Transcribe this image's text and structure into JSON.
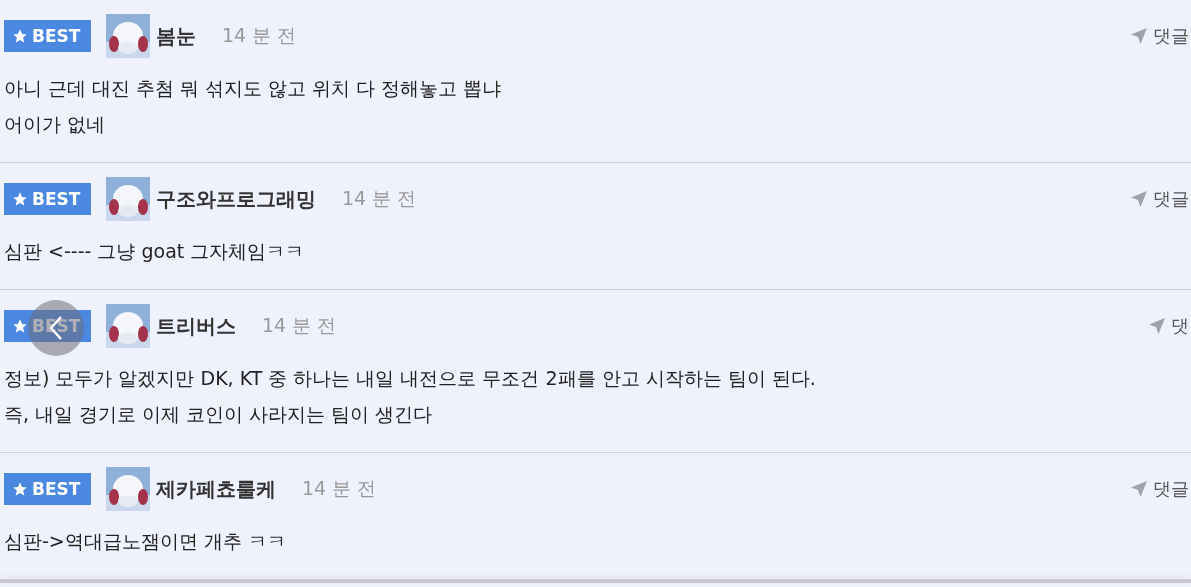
{
  "comments": [
    {
      "badge": "BEST",
      "author": "봄눈",
      "time": "14 분 전",
      "reply": "댓글",
      "lines": [
        "아니 근데 대진 추첨 뭐 섞지도 않고 위치 다 정해놓고 뽑냐",
        "어이가 없네"
      ]
    },
    {
      "badge": "BEST",
      "author": "구조와프로그래밍",
      "time": "14 분 전",
      "reply": "댓글",
      "lines": [
        "심판 <---- 그냥 goat 그자체임ㅋㅋ"
      ]
    },
    {
      "badge": "BEST",
      "author": "트리버스",
      "time": "14 분 전",
      "reply": "댓",
      "lines": [
        "정보) 모두가 알겠지만 DK, KT 중 하나는 내일 내전으로 무조건 2패를 안고 시작하는 팀이 된다.",
        "즉, 내일 경기로 이제 코인이 사라지는 팀이 생긴다"
      ]
    },
    {
      "badge": "BEST",
      "author": "제카페쵸룰케",
      "time": "14 분 전",
      "reply": "댓글",
      "lines": [
        "심판->역대급노잼이면 개추 ㅋㅋ"
      ]
    }
  ]
}
